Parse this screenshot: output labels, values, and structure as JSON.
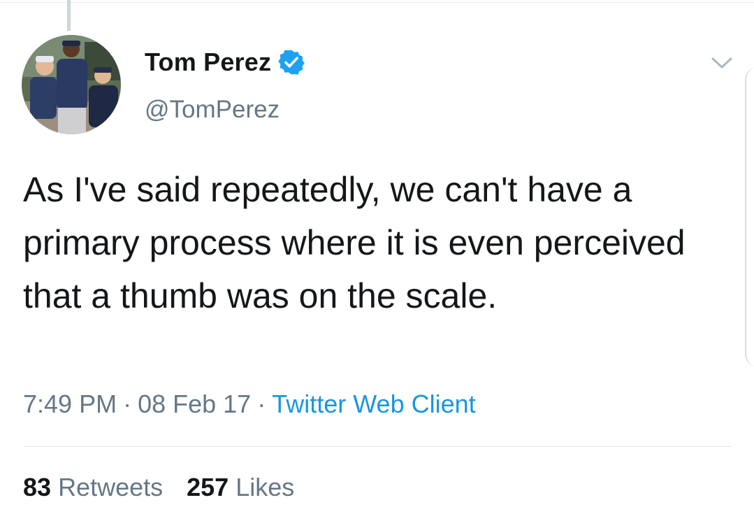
{
  "tweet": {
    "author": {
      "display_name": "Tom Perez",
      "handle": "@TomPerez",
      "verified": true,
      "avatar_icon": "profile-photo"
    },
    "text": "As I've said repeatedly, we can't have a primary process where it is even perceived that a thumb was on the scale.",
    "meta": {
      "time": "7:49 PM",
      "separator": "·",
      "date": "08 Feb 17",
      "client": "Twitter Web Client"
    },
    "stats": {
      "retweets_count": "83",
      "retweets_label": "Retweets",
      "likes_count": "257",
      "likes_label": "Likes"
    },
    "menu_icon": "chevron-down-icon"
  },
  "colors": {
    "primary_text": "#14171a",
    "secondary_text": "#657786",
    "link": "#1b95e0",
    "verified_badge": "#1da1f2",
    "divider": "#e1e8ed"
  }
}
